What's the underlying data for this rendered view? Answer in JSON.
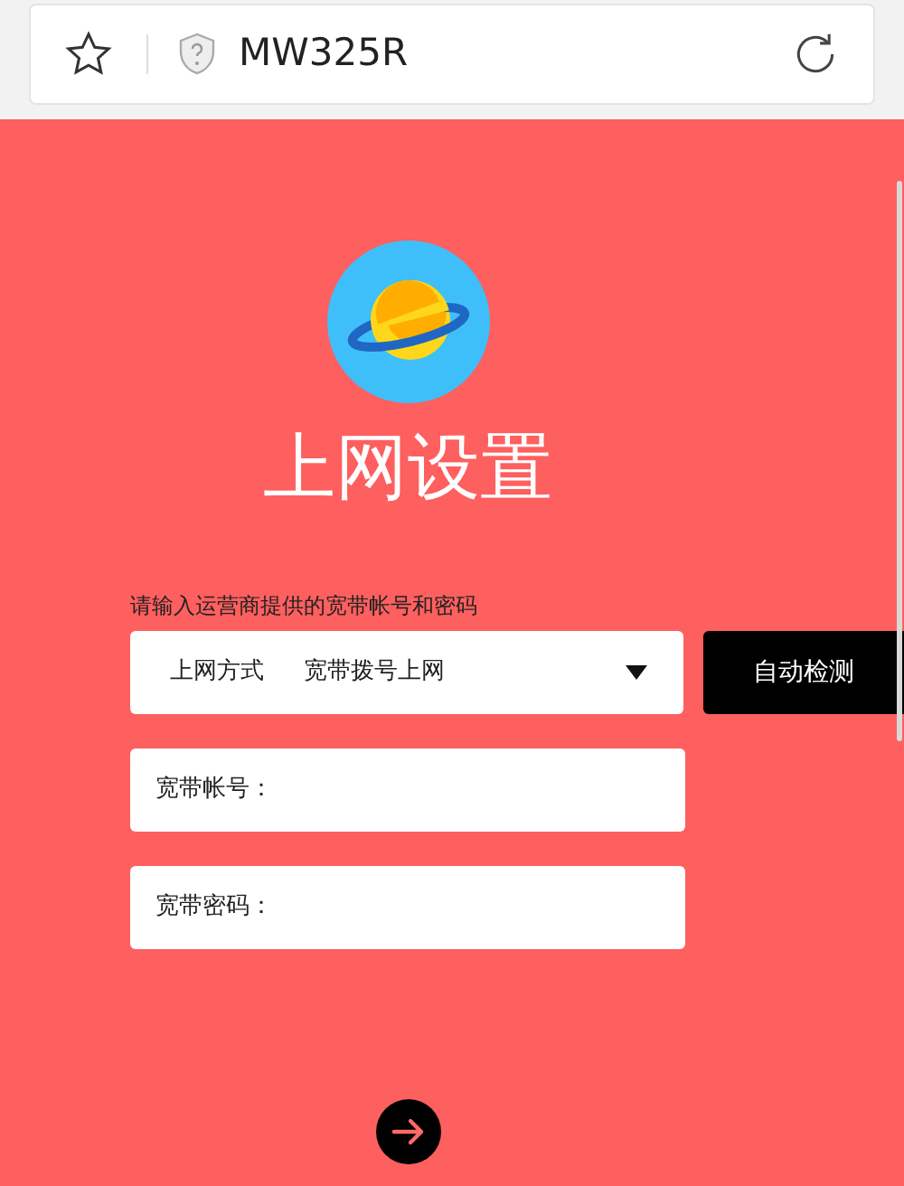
{
  "browser": {
    "address": "MW325R"
  },
  "page": {
    "title": "上网设置",
    "instruction": "请输入运营商提供的宽带帐号和密码"
  },
  "connection_type": {
    "label": "上网方式",
    "value": "宽带拨号上网"
  },
  "auto_detect_button": "自动检测",
  "fields": [
    {
      "label": "宽带帐号："
    },
    {
      "label": "宽带密码："
    }
  ]
}
